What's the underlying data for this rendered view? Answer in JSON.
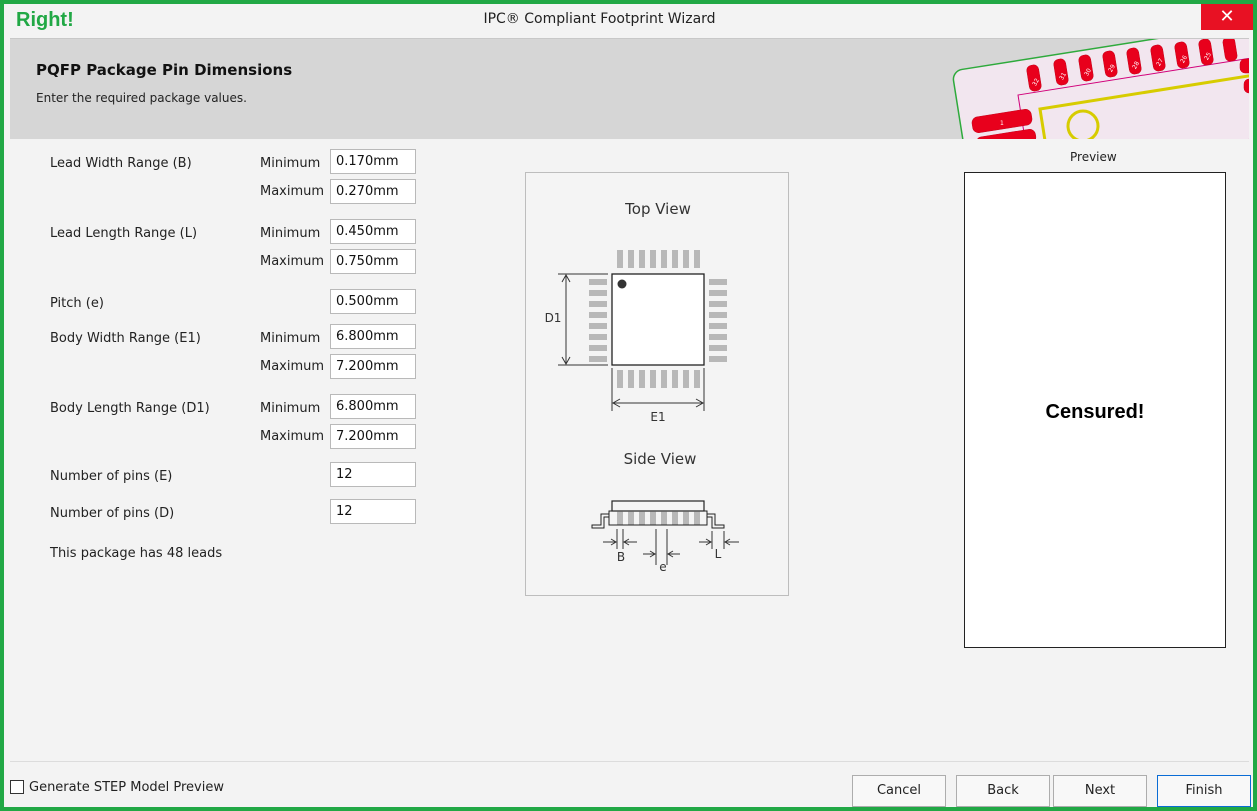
{
  "window": {
    "brand": "Right!",
    "title": "IPC® Compliant Footprint Wizard",
    "close_glyph": "✕"
  },
  "header": {
    "title": "PQFP Package Pin Dimensions",
    "subtitle": "Enter the required package values.",
    "pad_labels": [
      "32",
      "31",
      "30",
      "29",
      "28",
      "27",
      "26",
      "25",
      "1"
    ]
  },
  "form": {
    "lead_width": {
      "label": "Lead Width Range (B)",
      "min_label": "Minimum",
      "max_label": "Maximum",
      "min": "0.170mm",
      "max": "0.270mm"
    },
    "lead_length": {
      "label": "Lead Length Range (L)",
      "min_label": "Minimum",
      "max_label": "Maximum",
      "min": "0.450mm",
      "max": "0.750mm"
    },
    "pitch": {
      "label": "Pitch (e)",
      "value": "0.500mm"
    },
    "body_width": {
      "label": "Body Width Range (E1)",
      "min_label": "Minimum",
      "max_label": "Maximum",
      "min": "6.800mm",
      "max": "7.200mm"
    },
    "body_length": {
      "label": "Body Length Range (D1)",
      "min_label": "Minimum",
      "max_label": "Maximum",
      "min": "6.800mm",
      "max": "7.200mm"
    },
    "pins_e": {
      "label": "Number of pins (E)",
      "value": "12"
    },
    "pins_d": {
      "label": "Number of pins (D)",
      "value": "12"
    },
    "lead_count_text": "This package has 48 leads"
  },
  "diagram": {
    "top_view_title": "Top View",
    "side_view_title": "Side View",
    "d1": "D1",
    "e1": "E1",
    "b": "B",
    "e": "e",
    "l": "L"
  },
  "preview": {
    "label": "Preview",
    "message": "Censured!"
  },
  "footer": {
    "step_label": "Generate STEP Model Preview",
    "step_checked": false,
    "cancel": "Cancel",
    "back": "Back",
    "next": "Next",
    "finish": "Finish"
  },
  "colors": {
    "brand_green": "#21a845",
    "pad_red": "#e8001c",
    "silk_yellow": "#e8e800",
    "board_magenta": "#d1007a"
  }
}
